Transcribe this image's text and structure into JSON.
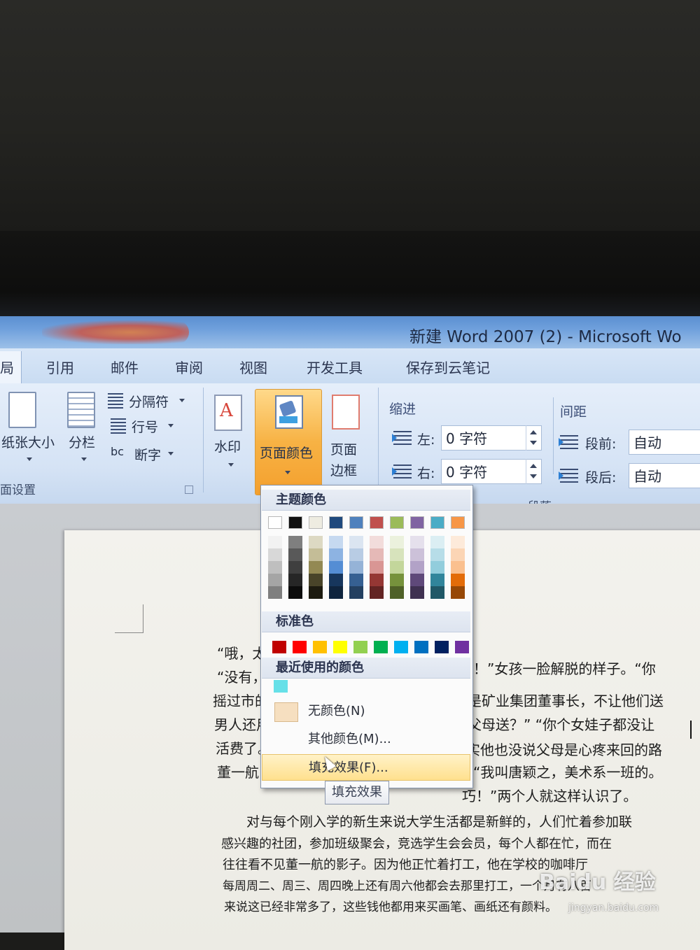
{
  "window": {
    "title": "新建 Word 2007 (2) - Microsoft Wo"
  },
  "tabs": [
    {
      "label": "局"
    },
    {
      "label": "引用"
    },
    {
      "label": "邮件"
    },
    {
      "label": "审阅"
    },
    {
      "label": "视图"
    },
    {
      "label": "开发工具"
    },
    {
      "label": "保存到云笔记"
    }
  ],
  "ribbon": {
    "page_setup": {
      "paper_size": "纸张大小",
      "columns": "分栏",
      "breaks": "分隔符",
      "line_numbers": "行号",
      "hyphenation": "断字",
      "group_label": "面设置"
    },
    "background": {
      "watermark": "水印",
      "page_color": "页面颜色",
      "page_borders_1": "页面",
      "page_borders_2": "边框"
    },
    "indent": {
      "header": "缩进",
      "left_label": "左:",
      "left_value": "0 字符",
      "right_label": "右:",
      "right_value": "0 字符"
    },
    "spacing": {
      "header": "间距",
      "before_label": "段前:",
      "before_value": "自动",
      "after_label": "段后:",
      "after_value": "自动"
    },
    "paragraph_group_label": "段落"
  },
  "dropdown": {
    "theme_header": "主题颜色",
    "standard_header": "标准色",
    "recent_header": "最近使用的颜色",
    "no_color": "无颜色(N)",
    "more_colors": "其他颜色(M)...",
    "fill_effects": "填充效果(F)...",
    "tooltip": "填充效果",
    "theme_top": [
      "#ffffff",
      "#111111",
      "#eeece1",
      "#1f497d",
      "#4f81bd",
      "#c0504d",
      "#9bbb59",
      "#8064a2",
      "#4bacc6",
      "#f79646"
    ],
    "theme_shades": [
      [
        "#f2f2f2",
        "#d8d8d8",
        "#bfbfbf",
        "#a5a5a5",
        "#7f7f7f"
      ],
      [
        "#7f7f7f",
        "#595959",
        "#3f3f3f",
        "#262626",
        "#0c0c0c"
      ],
      [
        "#ddd9c3",
        "#c4bd97",
        "#938953",
        "#494429",
        "#1d1b10"
      ],
      [
        "#c6d9f0",
        "#8db3e2",
        "#548dd4",
        "#17365d",
        "#0f243e"
      ],
      [
        "#dbe5f1",
        "#b8cce4",
        "#95b3d7",
        "#366092",
        "#244061"
      ],
      [
        "#f2dcdb",
        "#e5b9b7",
        "#d99694",
        "#953734",
        "#632423"
      ],
      [
        "#ebf1dd",
        "#d7e3bc",
        "#c3d69b",
        "#76923c",
        "#4f6128"
      ],
      [
        "#e5e0ec",
        "#ccc1d9",
        "#b2a2c7",
        "#5f497a",
        "#3f3151"
      ],
      [
        "#dbeef3",
        "#b7dde8",
        "#92cddc",
        "#31859b",
        "#205867"
      ],
      [
        "#fdeada",
        "#fbd5b5",
        "#fac08f",
        "#e36c09",
        "#974806"
      ]
    ],
    "standard": [
      "#c00000",
      "#ff0000",
      "#ffc000",
      "#ffff00",
      "#92d050",
      "#00b050",
      "#00b0f0",
      "#0070c0",
      "#002060",
      "#7030a0"
    ],
    "recent": [
      "#66e0e8"
    ]
  },
  "document": {
    "lines": [
      "“哦，太",
      "“没有，",
      "摇过市的",
      "男人还用",
      "活费了。",
      "董一航，",
      "！”女孩一脸解脱的样子。“你",
      "是矿业集团董事长，不让他们送",
      "父母送？” “你个女娃子都没让",
      "实他也没说父母是心疼来回的路",
      "“我叫唐颖之，美术系一班的。",
      "巧！”两个人就这样认识了。",
      "对与每个刚入学的新生来说大学生活都是新鲜的，人们忙着参加联",
      "感兴趣的社团，参加班级聚会，竞选学生会会员，每个人都在忙，而在",
      "往往看不见董一航的影子。因为他正忙着打工，他在学校的咖啡厅",
      "每周周二、周三、周四晚上还有周六他都会去那里打工，一个月有八百",
      "来说这已经非常多了，这些钱他都用来买画笔、画纸还有颜料。"
    ]
  },
  "watermark": {
    "logo": "Baidu 经验",
    "url": "jingyan.baidu.com"
  }
}
